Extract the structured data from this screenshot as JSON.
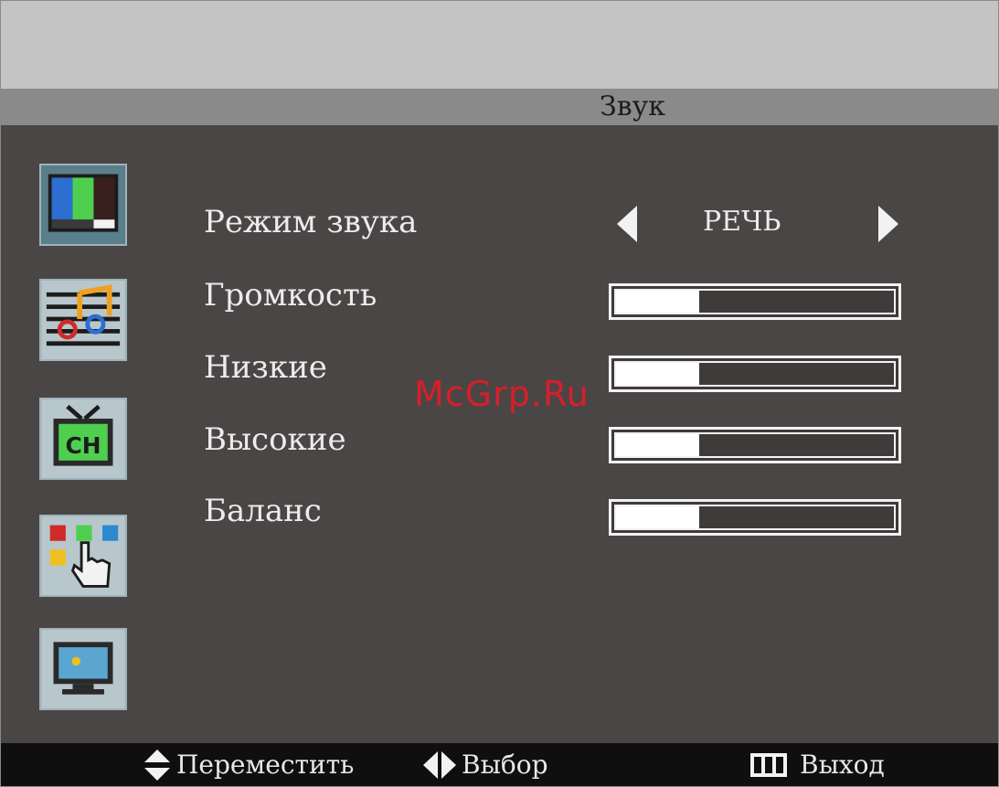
{
  "menu": {
    "title": "Звук"
  },
  "sidebar": {
    "items": [
      {
        "icon": "picture-icon"
      },
      {
        "icon": "sound-icon"
      },
      {
        "icon": "channel-icon"
      },
      {
        "icon": "features-icon"
      },
      {
        "icon": "screen-icon"
      }
    ]
  },
  "settings": {
    "sound_mode": {
      "label": "Режим звука",
      "value": "РЕЧЬ"
    },
    "volume": {
      "label": "Громкость",
      "level": 0.3
    },
    "bass": {
      "label": "Низкие",
      "level": 0.3
    },
    "treble": {
      "label": "Высокие",
      "level": 0.3
    },
    "balance": {
      "label": "Баланс",
      "level": 0.3
    }
  },
  "watermark": "McGrp.Ru",
  "footer": {
    "move": "Переместить",
    "select": "Выбор",
    "exit": "Выход"
  },
  "colors": {
    "background": "#4a4645",
    "title_bar": "#8a8a8a",
    "top_bar": "#c4c4c4",
    "footer": "#0f0f0f",
    "text": "#ececec",
    "watermark": "#d81e2a"
  }
}
